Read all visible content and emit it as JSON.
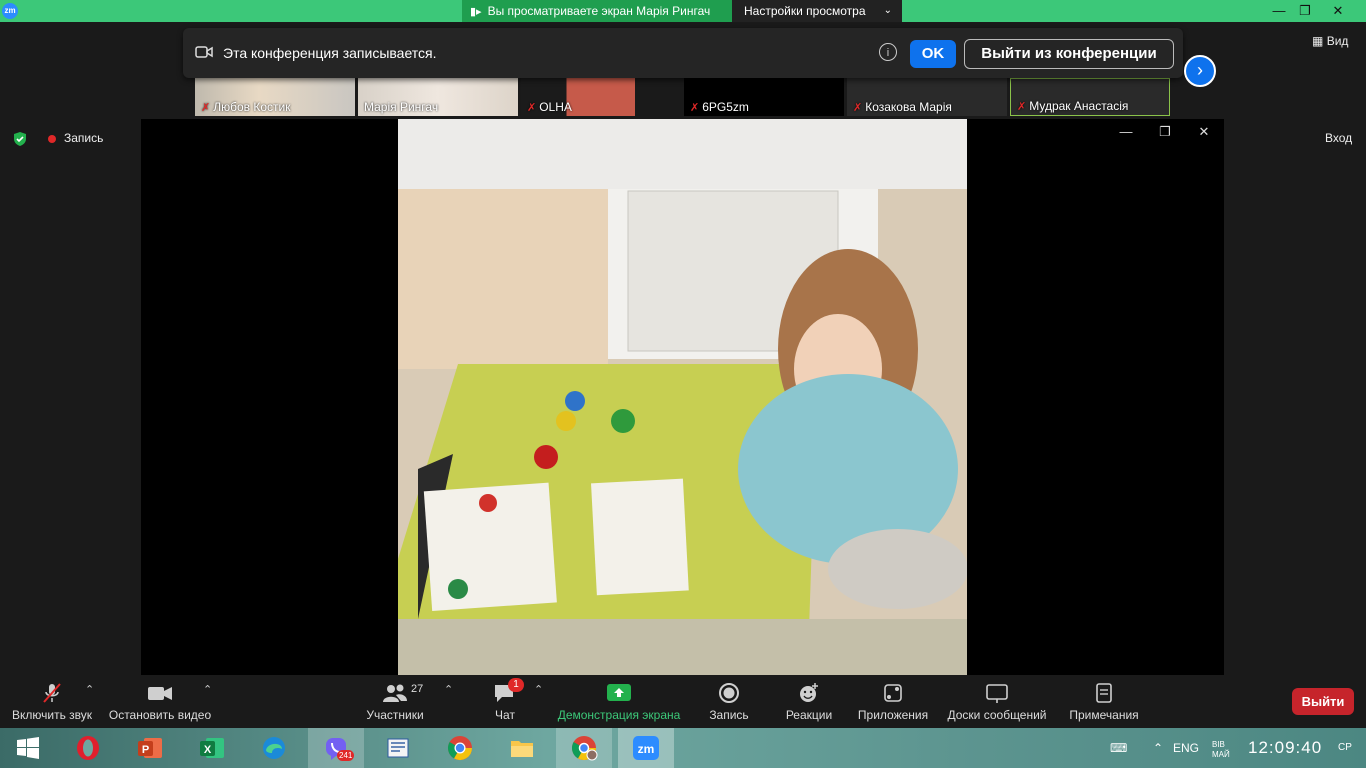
{
  "titlebar": {
    "app_logo": "zm",
    "share_banner": "Вы просматриваете экран Марія Рингач",
    "view_settings": "Настройки просмотра",
    "minimize_icon": "minimize-icon",
    "restore_icon": "restore-icon",
    "close_icon": "close-icon"
  },
  "participants": [
    {
      "name": "Любов Костик",
      "muted": true
    },
    {
      "name": "Марія Рингач",
      "muted": false
    },
    {
      "name": "OLHA",
      "muted": true
    },
    {
      "name": "6PG5zm",
      "muted": true
    },
    {
      "name": "Козакова Марія",
      "muted": true
    },
    {
      "name": "Мудрак Анастасія",
      "muted": true
    }
  ],
  "notice": {
    "text": "Эта конференция записывается.",
    "info": "i",
    "ok_label": "OK",
    "leave_label": "Выйти из конференции"
  },
  "view_label": "Вид",
  "status": {
    "recording_label": "Запись",
    "enter_label": "Вход"
  },
  "toolbar": {
    "audio_label": "Включить звук",
    "video_label": "Остановить видео",
    "participants_label": "Участники",
    "participants_count": "27",
    "chat_label": "Чат",
    "chat_badge": "1",
    "share_label": "Демонстрация экрана",
    "record_label": "Запись",
    "reactions_label": "Реакции",
    "apps_label": "Приложения",
    "whiteboard_label": "Доски сообщений",
    "notes_label": "Примечания",
    "exit_label": "Выйти"
  },
  "taskbar": {
    "viber_badge": "241",
    "lang": "ENG",
    "date_short": "ВІВ\nМАЙ",
    "time": "12:09:40",
    "day": "СР"
  },
  "colors": {
    "zoom_blue": "#0e72ed",
    "share_green": "#3cc879",
    "exit_red": "#c6242b",
    "toolbar_bg": "#1a1a1a"
  }
}
